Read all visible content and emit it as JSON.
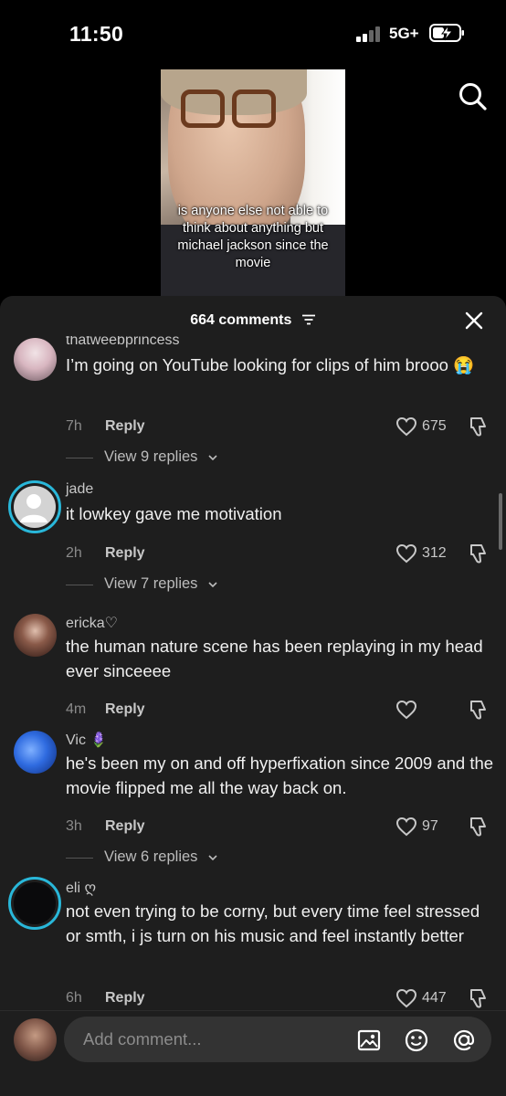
{
  "status": {
    "time": "11:50",
    "network": "5G+"
  },
  "video": {
    "caption": "is anyone else not able to think about anything but michael jackson since the movie"
  },
  "sheet": {
    "title": "664 comments"
  },
  "comments": [
    {
      "username": "thatweebprincess",
      "text": "I’m going on YouTube looking for clips of him brooo 😭",
      "age": "7h",
      "reply": "Reply",
      "likes": "675",
      "view_replies": "View 9 replies"
    },
    {
      "username": "jade",
      "text": "it lowkey gave me motivation",
      "age": "2h",
      "reply": "Reply",
      "likes": "312",
      "view_replies": "View 7 replies"
    },
    {
      "username": "ericka♡",
      "text": "the human nature scene has been replaying in my head ever sinceeee",
      "age": "4m",
      "reply": "Reply",
      "likes": ""
    },
    {
      "username": "Vic 🪻",
      "text": "he's been my on and off hyperfixation since 2009 and the movie flipped me all the way back on.",
      "age": "3h",
      "reply": "Reply",
      "likes": "97",
      "view_replies": "View 6 replies"
    },
    {
      "username": "eli ღ",
      "text": "not even trying to be corny, but every time feel stressed or smth, i js turn on his music and feel instantly better",
      "age": "6h",
      "reply": "Reply",
      "likes": "447"
    }
  ],
  "composer": {
    "placeholder": "Add comment..."
  },
  "icons": {
    "search": "search-icon",
    "close": "close-icon",
    "sort": "sort-icon",
    "like": "heart-outline-icon",
    "dislike": "thumbs-down-icon",
    "image": "image-icon",
    "emoji": "emoji-icon",
    "mention": "at-icon"
  },
  "colors": {
    "sheet_bg": "#1e1e1e",
    "story_ring": "#29b7d9",
    "input_bg": "#333333"
  }
}
